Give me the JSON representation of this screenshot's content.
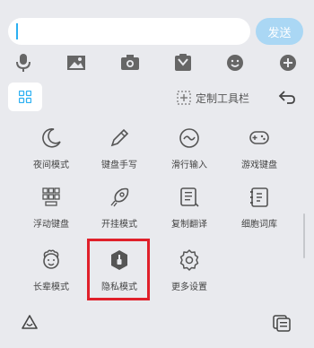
{
  "input": {
    "value": ""
  },
  "send_label": "发送",
  "toolbar_icons": [
    "microphone-icon",
    "image-icon",
    "camera-icon",
    "clipboard-icon",
    "emoji-icon",
    "plus-icon"
  ],
  "panel": {
    "custom_toolbar_label": "定制工具栏"
  },
  "grid_items": [
    {
      "label": "夜间模式",
      "icon": "moon-icon"
    },
    {
      "label": "键盘手写",
      "icon": "pen-icon"
    },
    {
      "label": "滑行输入",
      "icon": "swipe-icon"
    },
    {
      "label": "游戏键盘",
      "icon": "gamepad-icon"
    },
    {
      "label": "浮动键盘",
      "icon": "floating-keyboard-icon"
    },
    {
      "label": "开挂模式",
      "icon": "rocket-icon"
    },
    {
      "label": "复制翻译",
      "icon": "translate-icon"
    },
    {
      "label": "细胞词库",
      "icon": "dictionary-icon"
    },
    {
      "label": "长辈模式",
      "icon": "elder-face-icon"
    },
    {
      "label": "隐私模式",
      "icon": "privacy-shield-icon",
      "selected": true
    },
    {
      "label": "更多设置",
      "icon": "gear-icon"
    }
  ],
  "bottom_icons": [
    "app-logo-icon",
    "keyboard-collapse-icon"
  ],
  "colors": {
    "accent": "#2bb0f2",
    "highlight": "#e0202a",
    "icon": "#555555"
  }
}
